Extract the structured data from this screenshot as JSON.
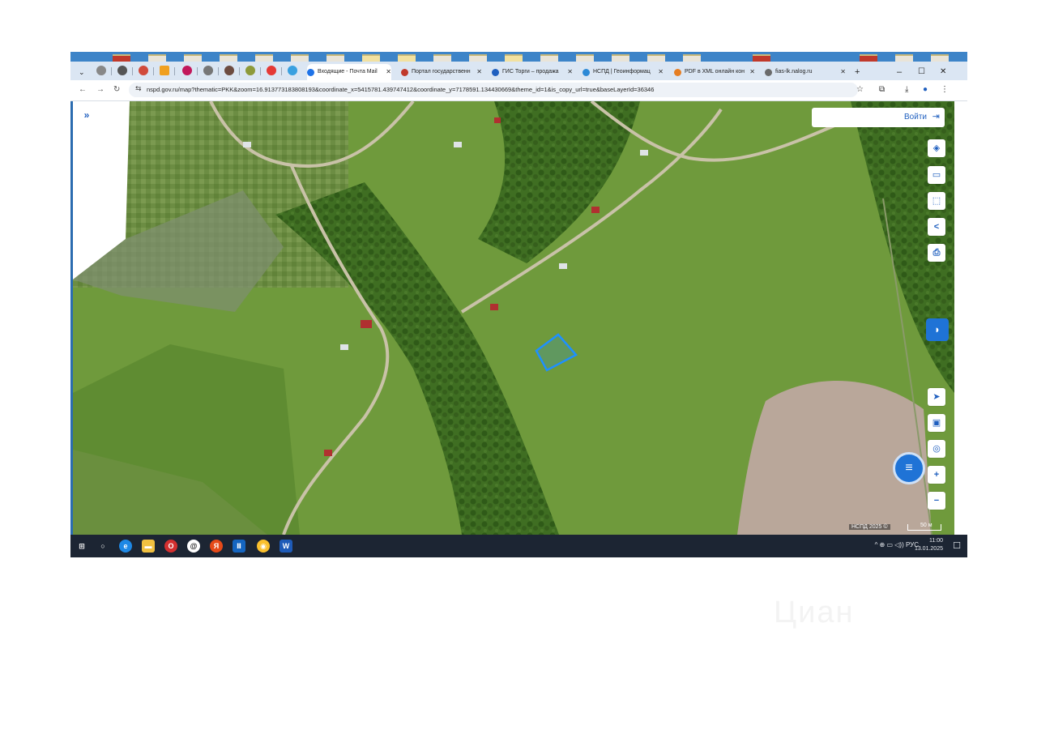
{
  "browser": {
    "tabs": [
      {
        "label": "Входящие - Почта Mail",
        "color": "#1e73e8"
      },
      {
        "label": "Портал государственн",
        "color": "#c0392b"
      },
      {
        "label": "ГИС Торги – продажа",
        "color": "#1f5fbf"
      },
      {
        "label": "НСПД | Геоинформац",
        "color": "#2c89d6"
      },
      {
        "label": "PDF в XML онлайн кон",
        "color": "#e67e22"
      },
      {
        "label": "fias-lk.nalog.ru",
        "color": "#6b6b6b"
      }
    ],
    "new_tab": "+",
    "window_controls": {
      "minimize": "–",
      "maximize": "☐",
      "close": "✕"
    },
    "url": "nspd.gov.ru/map?thematic=PKK&zoom=16.913773183808193&coordinate_x=5415781.439747412&coordinate_y=7178591.134430669&theme_id=1&is_copy_url=true&baseLayerId=36346"
  },
  "map": {
    "login_label": "Войти",
    "attribution": "НСПД 2025 ©",
    "scale_label": "50 м",
    "highlight_color": "#1e90ff"
  },
  "taskbar": {
    "language": "РУС",
    "time": "11:00",
    "date": "13.01.2025"
  },
  "watermark": "Циан"
}
